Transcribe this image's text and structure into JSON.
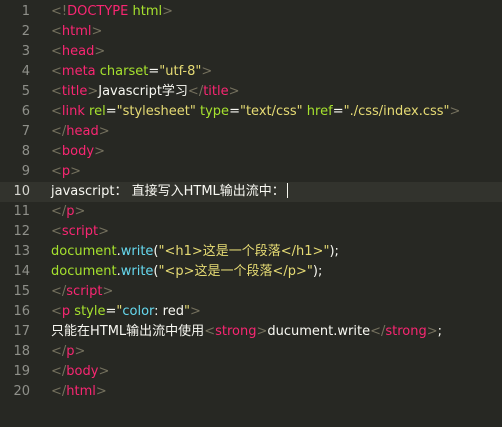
{
  "editor": {
    "lines": [
      {
        "n": "1",
        "tokens": [
          {
            "t": "<!",
            "c": "br"
          },
          {
            "t": "DOCTYPE",
            "c": "tag"
          },
          {
            "t": " html",
            "c": "attr"
          },
          {
            "t": ">",
            "c": "br"
          }
        ]
      },
      {
        "n": "2",
        "tokens": [
          {
            "t": "<",
            "c": "br"
          },
          {
            "t": "html",
            "c": "tag"
          },
          {
            "t": ">",
            "c": "br"
          }
        ]
      },
      {
        "n": "3",
        "tokens": [
          {
            "t": "<",
            "c": "br"
          },
          {
            "t": "head",
            "c": "tag"
          },
          {
            "t": ">",
            "c": "br"
          }
        ]
      },
      {
        "n": "4",
        "tokens": [
          {
            "t": "<",
            "c": "br"
          },
          {
            "t": "meta",
            "c": "tag"
          },
          {
            "t": " charset",
            "c": "attr"
          },
          {
            "t": "=",
            "c": "txt"
          },
          {
            "t": "\"utf-8\"",
            "c": "str"
          },
          {
            "t": ">",
            "c": "br"
          }
        ]
      },
      {
        "n": "5",
        "tokens": [
          {
            "t": "<",
            "c": "br"
          },
          {
            "t": "title",
            "c": "tag"
          },
          {
            "t": ">",
            "c": "br"
          },
          {
            "t": "Javascript学习",
            "c": "txt"
          },
          {
            "t": "</",
            "c": "br"
          },
          {
            "t": "title",
            "c": "tag"
          },
          {
            "t": ">",
            "c": "br"
          }
        ]
      },
      {
        "n": "6",
        "tokens": [
          {
            "t": "<",
            "c": "br"
          },
          {
            "t": "link",
            "c": "tag"
          },
          {
            "t": " rel",
            "c": "attr"
          },
          {
            "t": "=",
            "c": "txt"
          },
          {
            "t": "\"stylesheet\"",
            "c": "str"
          },
          {
            "t": " type",
            "c": "attr"
          },
          {
            "t": "=",
            "c": "txt"
          },
          {
            "t": "\"text/css\"",
            "c": "str"
          },
          {
            "t": " href",
            "c": "attr"
          },
          {
            "t": "=",
            "c": "txt"
          },
          {
            "t": "\"./css/index.css\"",
            "c": "str"
          },
          {
            "t": ">",
            "c": "br"
          }
        ]
      },
      {
        "n": "7",
        "tokens": [
          {
            "t": "</",
            "c": "br"
          },
          {
            "t": "head",
            "c": "tag"
          },
          {
            "t": ">",
            "c": "br"
          }
        ]
      },
      {
        "n": "8",
        "tokens": [
          {
            "t": "<",
            "c": "br"
          },
          {
            "t": "body",
            "c": "tag"
          },
          {
            "t": ">",
            "c": "br"
          }
        ]
      },
      {
        "n": "9",
        "tokens": [
          {
            "t": "<",
            "c": "br"
          },
          {
            "t": "p",
            "c": "tag"
          },
          {
            "t": ">",
            "c": "br"
          }
        ]
      },
      {
        "n": "10",
        "current": true,
        "tokens": [
          {
            "t": "javascript： 直接写入HTML输出流中：",
            "c": "txt"
          }
        ]
      },
      {
        "n": "11",
        "tokens": [
          {
            "t": "</",
            "c": "br"
          },
          {
            "t": "p",
            "c": "tag"
          },
          {
            "t": ">",
            "c": "br"
          }
        ]
      },
      {
        "n": "12",
        "tokens": [
          {
            "t": "<",
            "c": "br"
          },
          {
            "t": "script",
            "c": "tag"
          },
          {
            "t": ">",
            "c": "br"
          }
        ]
      },
      {
        "n": "13",
        "tokens": [
          {
            "t": "document",
            "c": "fn"
          },
          {
            "t": ".",
            "c": "txt"
          },
          {
            "t": "write",
            "c": "kw"
          },
          {
            "t": "(",
            "c": "txt"
          },
          {
            "t": "\"<h1>这是一个段落</h1>\"",
            "c": "str"
          },
          {
            "t": ");",
            "c": "txt"
          }
        ]
      },
      {
        "n": "14",
        "tokens": [
          {
            "t": "document",
            "c": "fn"
          },
          {
            "t": ".",
            "c": "txt"
          },
          {
            "t": "write",
            "c": "kw"
          },
          {
            "t": "(",
            "c": "txt"
          },
          {
            "t": "\"<p>这是一个段落</p>\"",
            "c": "str"
          },
          {
            "t": ");",
            "c": "txt"
          }
        ]
      },
      {
        "n": "15",
        "tokens": [
          {
            "t": "</",
            "c": "br"
          },
          {
            "t": "script",
            "c": "tag"
          },
          {
            "t": ">",
            "c": "br"
          }
        ]
      },
      {
        "n": "16",
        "tokens": [
          {
            "t": "<",
            "c": "br"
          },
          {
            "t": "p",
            "c": "tag"
          },
          {
            "t": " style",
            "c": "attr"
          },
          {
            "t": "=",
            "c": "txt"
          },
          {
            "t": "\"",
            "c": "str"
          },
          {
            "t": "color",
            "c": "kw"
          },
          {
            "t": ": red",
            "c": "txt"
          },
          {
            "t": "\"",
            "c": "str"
          },
          {
            "t": ">",
            "c": "br"
          }
        ]
      },
      {
        "n": "17",
        "tokens": [
          {
            "t": "只能在HTML输出流中使用",
            "c": "txt"
          },
          {
            "t": "<",
            "c": "br"
          },
          {
            "t": "strong",
            "c": "tag"
          },
          {
            "t": ">",
            "c": "br"
          },
          {
            "t": "ducument.write",
            "c": "txt"
          },
          {
            "t": "</",
            "c": "br"
          },
          {
            "t": "strong",
            "c": "tag"
          },
          {
            "t": ">",
            "c": "br"
          },
          {
            "t": ";",
            "c": "txt"
          }
        ]
      },
      {
        "n": "18",
        "tokens": [
          {
            "t": "</",
            "c": "br"
          },
          {
            "t": "p",
            "c": "tag"
          },
          {
            "t": ">",
            "c": "br"
          }
        ]
      },
      {
        "n": "19",
        "tokens": [
          {
            "t": "</",
            "c": "br"
          },
          {
            "t": "body",
            "c": "tag"
          },
          {
            "t": ">",
            "c": "br"
          }
        ]
      },
      {
        "n": "20",
        "tokens": [
          {
            "t": "</",
            "c": "br"
          },
          {
            "t": "html",
            "c": "tag"
          },
          {
            "t": ">",
            "c": "br"
          }
        ]
      }
    ]
  },
  "colors": {
    "background": "#272823",
    "current_line": "#32332d",
    "tag": "#f92672",
    "attribute": "#a6e22e",
    "string": "#e6db74",
    "text": "#f8f8f2",
    "punctuation": "#75715e",
    "keyword": "#66d9ef"
  }
}
